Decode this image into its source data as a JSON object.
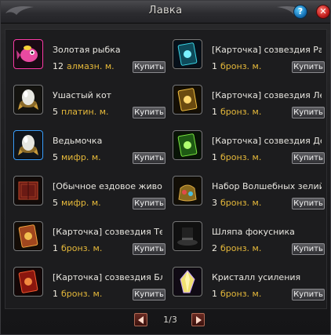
{
  "window": {
    "title": "Лавка"
  },
  "colors": {
    "currency": "#e6b93a",
    "text": "#e8e6e0",
    "close": "#c21d1d",
    "help": "#1774b8"
  },
  "items_left": [
    {
      "name": "Золотая рыбка",
      "amount": "12",
      "currency": "алмазн. м.",
      "buy": "Купить",
      "icon": "goldfish-icon"
    },
    {
      "name": "Ушастый кот",
      "amount": "5",
      "currency": "платин. м.",
      "buy": "Купить",
      "icon": "egg-pet-icon"
    },
    {
      "name": "Ведьмочка",
      "amount": "5",
      "currency": "мифр. м.",
      "buy": "Купить",
      "icon": "egg-pet-icon"
    },
    {
      "name": "[Обычное ездовое живот",
      "amount": "5",
      "currency": "мифр. м.",
      "buy": "Купить",
      "icon": "mount-book-icon"
    },
    {
      "name": "[Карточка] созвездия Те",
      "amount": "1",
      "currency": "бронз. м.",
      "buy": "Купить",
      "icon": "zodiac-card-icon"
    },
    {
      "name": "[Карточка] созвездия Бл",
      "amount": "1",
      "currency": "бронз. м.",
      "buy": "Купить",
      "icon": "zodiac-card-icon"
    }
  ],
  "items_right": [
    {
      "name": "[Карточка] созвездия Рак",
      "amount": "1",
      "currency": "бронз. м.",
      "buy": "Купить",
      "icon": "zodiac-card-icon"
    },
    {
      "name": "[Карточка] созвездия Лев",
      "amount": "1",
      "currency": "бронз. м.",
      "buy": "Купить",
      "icon": "zodiac-card-icon"
    },
    {
      "name": "[Карточка] созвездия Дев",
      "amount": "1",
      "currency": "бронз. м.",
      "buy": "Купить",
      "icon": "zodiac-card-icon"
    },
    {
      "name": "Набор Волшебных зелий",
      "amount": "3",
      "currency": "бронз. м.",
      "buy": "Купить",
      "icon": "potion-bag-icon"
    },
    {
      "name": "Шляпа фокусника",
      "amount": "2",
      "currency": "бронз. м.",
      "buy": "Купить",
      "icon": "top-hat-icon"
    },
    {
      "name": "Кристалл усиления",
      "amount": "1",
      "currency": "бронз. м.",
      "buy": "Купить",
      "icon": "crystal-icon"
    }
  ],
  "pager": {
    "text": "1/3"
  },
  "buttons": {
    "help": "?",
    "close": "✕"
  }
}
